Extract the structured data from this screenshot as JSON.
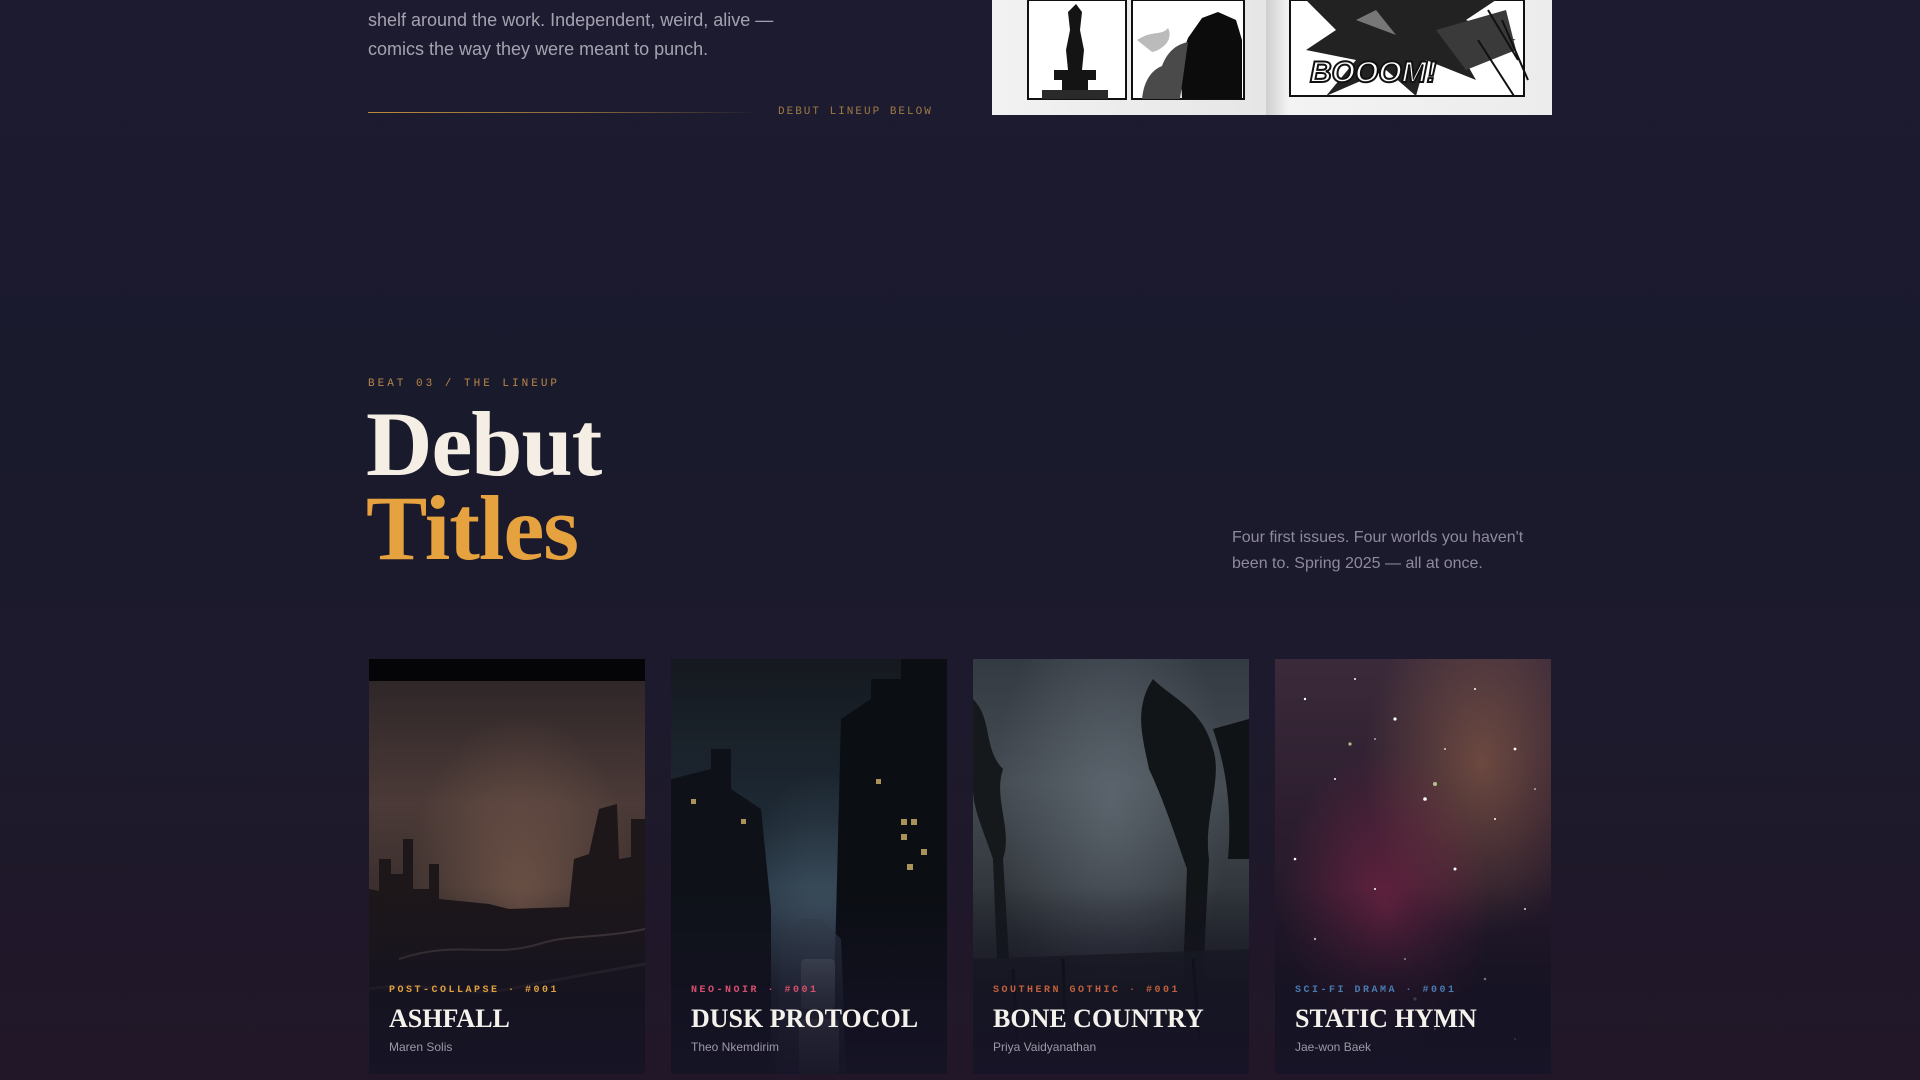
{
  "intro": {
    "lines": [
      "shelf around the work. Independent, weird, alive —",
      "comics the way they were meant to punch."
    ],
    "lineup_link": "DEBUT LINEUP BELOW"
  },
  "comic_image": {
    "sfx_text": "BOOOM!"
  },
  "lineup": {
    "eyebrow": "BEAT 03 / THE LINEUP",
    "title_line_1": "Debut",
    "title_line_2": "Titles",
    "description": "Four first issues. Four worlds you haven't been to. Spring 2025 — all at once."
  },
  "cards": [
    {
      "genre": "POST-COLLAPSE · #001",
      "title": "ASHFALL",
      "creator": "Maren Solis",
      "accent": "#e0a040"
    },
    {
      "genre": "NEO-NOIR · #001",
      "title": "DUSK PROTOCOL",
      "creator": "Theo Nkemdirim",
      "accent": "#d94e6c"
    },
    {
      "genre": "SOUTHERN GOTHIC · #001",
      "title": "BONE COUNTRY",
      "creator": "Priya Vaidyanathan",
      "accent": "#c0603c"
    },
    {
      "genre": "SCI-FI DRAMA · #001",
      "title": "STATIC HYMN",
      "creator": "Jae-won Baek",
      "accent": "#4a7ab0"
    }
  ],
  "colors": {
    "accent_gold": "#e6a23e",
    "background": "#1c1a2c"
  }
}
